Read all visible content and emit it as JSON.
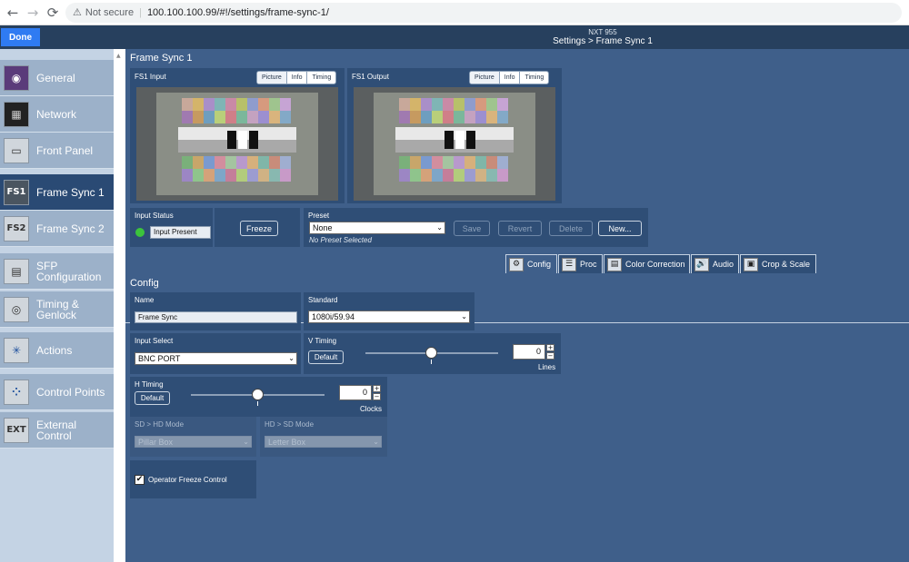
{
  "browser": {
    "back_icon": "←",
    "forward_icon": "→",
    "reload_icon": "⟳",
    "warning_icon": "⚠",
    "security_text": "Not secure",
    "url": "100.100.100.99/#!/settings/frame-sync-1/"
  },
  "header": {
    "done_label": "Done",
    "device": "NXT 955",
    "breadcrumb": "Settings > Frame Sync 1"
  },
  "sidebar": {
    "items": [
      {
        "label": "General",
        "icon": "eye-icon",
        "glyph": "◉"
      },
      {
        "label": "Network",
        "icon": "network-icon",
        "glyph": "▦"
      },
      {
        "label": "Front Panel",
        "icon": "front-panel-icon",
        "glyph": "▭"
      },
      {
        "label": "Frame Sync 1",
        "icon": "fs1-icon",
        "glyph": "FS1"
      },
      {
        "label": "Frame Sync 2",
        "icon": "fs2-icon",
        "glyph": "FS2"
      },
      {
        "label": "SFP Configuration",
        "icon": "sfp-icon",
        "glyph": "▤"
      },
      {
        "label": "Timing & Genlock",
        "icon": "ref-icon",
        "glyph": "◎"
      },
      {
        "label": "Actions",
        "icon": "actions-icon",
        "glyph": "✳"
      },
      {
        "label": "Control Points",
        "icon": "control-points-icon",
        "glyph": "⁘"
      },
      {
        "label": "External Control",
        "icon": "ext-icon",
        "glyph": "EXT"
      }
    ],
    "scroll_icon": "▲"
  },
  "main": {
    "title": "Frame Sync 1",
    "fs1_input": {
      "label": "FS1 Input",
      "tabs": [
        "Picture",
        "Info",
        "Timing"
      ]
    },
    "fs1_output": {
      "label": "FS1 Output",
      "tabs": [
        "Picture",
        "Info",
        "Timing"
      ]
    },
    "input_status": {
      "label": "Input Status",
      "value": "Input Present",
      "indicator_color": "#3cc43c"
    },
    "freeze_label": "Freeze",
    "preset": {
      "label": "Preset",
      "selected": "None",
      "save": "Save",
      "revert": "Revert",
      "delete": "Delete",
      "new": "New...",
      "status": "No Preset Selected"
    },
    "tabs": [
      {
        "label": "Config",
        "icon": "gear-icon",
        "glyph": "⚙"
      },
      {
        "label": "Proc",
        "icon": "proc-icon",
        "glyph": "☰"
      },
      {
        "label": "Color Correction",
        "icon": "color-correction-icon",
        "glyph": "▤"
      },
      {
        "label": "Audio",
        "icon": "audio-icon",
        "glyph": "🔊"
      },
      {
        "label": "Crop & Scale",
        "icon": "crop-icon",
        "glyph": "▣"
      }
    ],
    "config": {
      "title": "Config",
      "name_label": "Name",
      "name_value": "Frame Sync",
      "standard_label": "Standard",
      "standard_value": "1080i/59.94",
      "input_select_label": "Input Select",
      "input_select_value": "BNC PORT",
      "v_timing": {
        "label": "V Timing",
        "default": "Default",
        "value": "0",
        "unit": "Lines",
        "level_pct": 50
      },
      "h_timing": {
        "label": "H Timing",
        "default": "Default",
        "value": "0",
        "unit": "Clocks",
        "level_pct": 50
      },
      "sd_hd_label": "SD > HD Mode",
      "sd_hd_value": "Pillar Box",
      "hd_sd_label": "HD > SD Mode",
      "hd_sd_value": "Letter Box",
      "operator_freeze_label": "Operator Freeze Control",
      "operator_freeze_checked": true,
      "check_glyph": "✔",
      "plus_glyph": "+",
      "minus_glyph": "−",
      "select_arrow": "⌄"
    }
  },
  "colors": {
    "header": "#27405e",
    "main_bg": "#3f5f8a",
    "panel": "#2f4e76",
    "sidebar_active": "#2a4a74",
    "done": "#2f7bf2"
  }
}
